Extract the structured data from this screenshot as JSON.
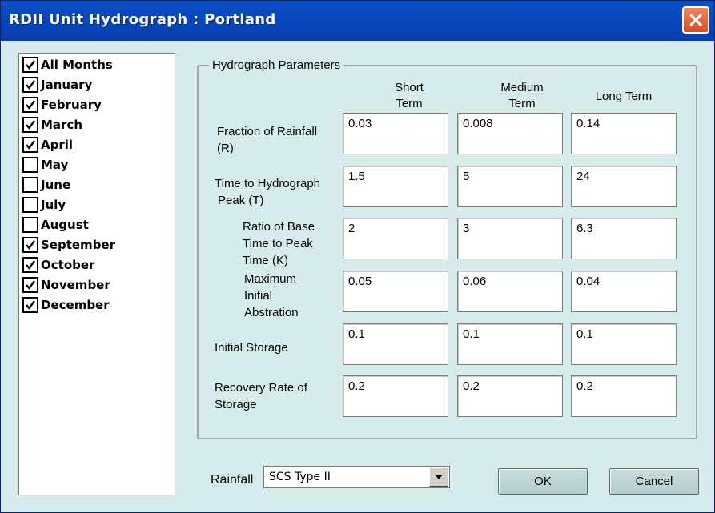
{
  "window": {
    "title": "RDII Unit Hydrograph : Portland"
  },
  "months": [
    {
      "label": "All Months",
      "checked": true
    },
    {
      "label": "January",
      "checked": true
    },
    {
      "label": "February",
      "checked": true
    },
    {
      "label": "March",
      "checked": true
    },
    {
      "label": "April",
      "checked": true
    },
    {
      "label": "May",
      "checked": false
    },
    {
      "label": "June",
      "checked": false
    },
    {
      "label": "July",
      "checked": false
    },
    {
      "label": "August",
      "checked": false
    },
    {
      "label": "September",
      "checked": true
    },
    {
      "label": "October",
      "checked": true
    },
    {
      "label": "November",
      "checked": true
    },
    {
      "label": "December",
      "checked": true
    }
  ],
  "params": {
    "title": "Hydrograph Parameters",
    "columns": {
      "short_1": "Short",
      "short_2": "Term",
      "medium_1": "Medium",
      "medium_2": "Term",
      "long": "Long Term"
    },
    "rows": [
      {
        "label_1": "Fraction of Rainfall",
        "label_2": "(R)",
        "short": "0.03",
        "medium": "0.008",
        "long": "0.14"
      },
      {
        "label_1": "Time to Hydrograph",
        "label_2": "Peak (T)",
        "short": "1.5",
        "medium": "5",
        "long": "24"
      },
      {
        "label_1": "Ratio of Base",
        "label_2": "Time to Peak",
        "label_3": "Time (K)",
        "short": "2",
        "medium": "3",
        "long": "6.3"
      },
      {
        "label_1": "Maximum",
        "label_2": "Initial",
        "label_3": "Abstration",
        "short": "0.05",
        "medium": "0.06",
        "long": "0.04"
      },
      {
        "label_1": "Initial Storage",
        "short": "0.1",
        "medium": "0.1",
        "long": "0.1"
      },
      {
        "label_1": "Recovery Rate of",
        "label_2": "Storage",
        "short": "0.2",
        "medium": "0.2",
        "long": "0.2"
      }
    ]
  },
  "rainfall": {
    "label": "Rainfall",
    "value": "SCS Type II"
  },
  "buttons": {
    "ok": "OK",
    "cancel": "Cancel"
  },
  "colors": {
    "titlebar": "#0a4ac0",
    "dialog_bg": "#d6ecec",
    "close": "#d84e20"
  }
}
